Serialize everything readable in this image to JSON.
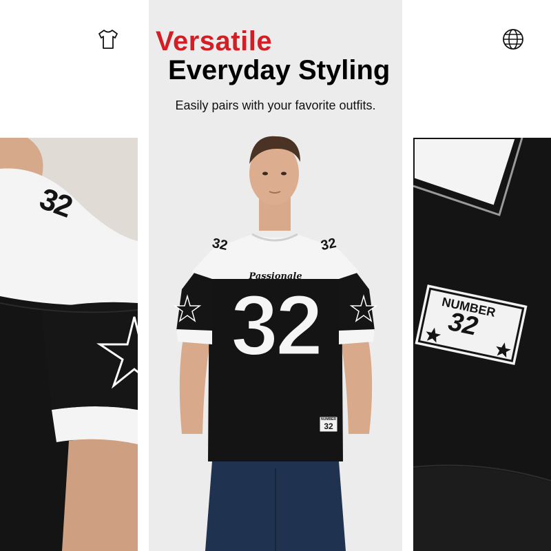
{
  "header": {
    "title_line1": "Versatile",
    "title_line2": "Everyday Styling",
    "subtitle": "Easily pairs with your favorite outfits.",
    "left_icon": "tshirt-icon",
    "right_icon": "globe-icon"
  },
  "shirt": {
    "script_text": "Passionale",
    "front_number": "32",
    "tag_small_label": "NUMBER",
    "tag_small_number": "32"
  },
  "detail_right": {
    "tag_label": "NUMBER",
    "tag_number": "32"
  },
  "detail_left": {
    "sleeve_number": "32"
  },
  "colors": {
    "accent_red": "#d21f26",
    "shirt_black": "#141414",
    "shirt_white": "#f7f7f7",
    "jeans_blue": "#1f3350",
    "background_gray": "#ececec"
  }
}
